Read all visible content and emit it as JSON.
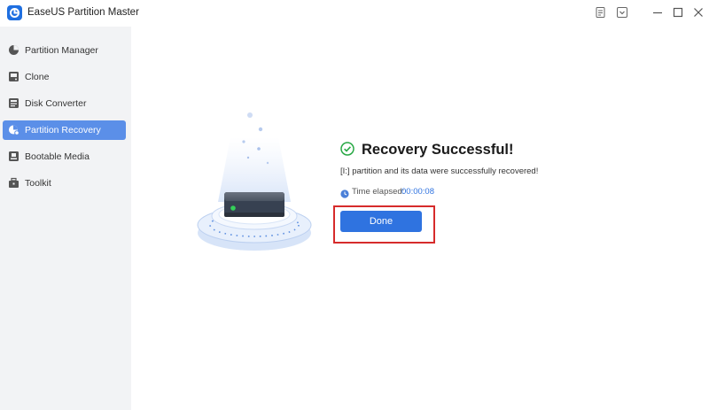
{
  "window": {
    "title": "EaseUS Partition Master",
    "icons": [
      "app-logo",
      "feedback-icon",
      "dropdown-icon",
      "minimize-icon",
      "maximize-icon",
      "close-icon"
    ]
  },
  "sidebar": {
    "items": [
      {
        "label": "Partition Manager",
        "icon": "pie-chart-icon",
        "active": false
      },
      {
        "label": "Clone",
        "icon": "clone-icon",
        "active": false
      },
      {
        "label": "Disk Converter",
        "icon": "disk-converter-icon",
        "active": false
      },
      {
        "label": "Partition Recovery",
        "icon": "partition-recovery-icon",
        "active": true
      },
      {
        "label": "Bootable Media",
        "icon": "bootable-media-icon",
        "active": false
      },
      {
        "label": "Toolkit",
        "icon": "toolkit-icon",
        "active": false
      }
    ]
  },
  "main": {
    "title": "Recovery Successful!",
    "message": "[I:] partition and its data were successfully recovered!",
    "elapsed_label": "Time elapsed:",
    "elapsed_value": "00:00:08",
    "done_label": "Done"
  },
  "colors": {
    "accent": "#2f73e0",
    "sidebar_active": "#5b8fe8",
    "success_green": "#27a844",
    "highlight_red": "#d62b2b"
  }
}
